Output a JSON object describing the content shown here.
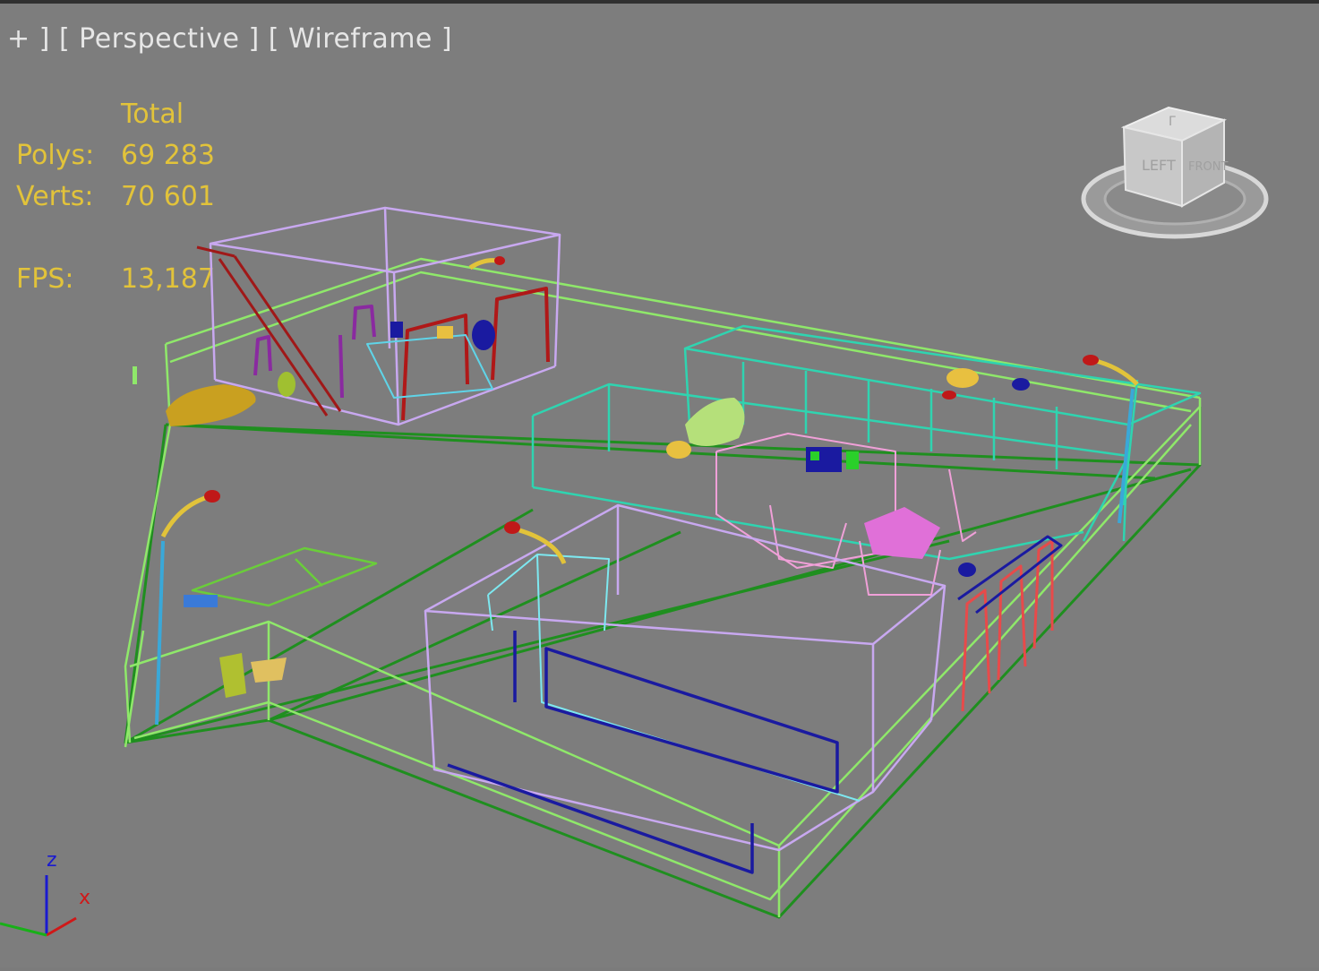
{
  "viewport": {
    "menu_label": "+ ]",
    "view_label": "[ Perspective ]",
    "shading_label": "[ Wireframe ]"
  },
  "stats": {
    "header": "Total",
    "polys_label": "Polys:",
    "polys_value": "69 283",
    "verts_label": "Verts:",
    "verts_value": "70 601",
    "fps_label": "FPS:",
    "fps_value": "13,187"
  },
  "viewcube": {
    "left_face": "LEFT",
    "front_face": "FRONT",
    "top_face": "Г"
  },
  "axis_gizmo": {
    "z": "z",
    "x": "x"
  },
  "colors": {
    "background": "#7d7d7d",
    "stats_text": "#e2c33a",
    "label_text": "#e6e6e6",
    "wire_green": "#2a9a2a",
    "wire_lightgreen": "#9ff07a",
    "wire_lilac": "#c8a8f0",
    "wire_teal": "#2fd4b0",
    "wire_red": "#b01818",
    "wire_blue": "#1a1aa0",
    "wire_pink": "#f07ad8"
  }
}
